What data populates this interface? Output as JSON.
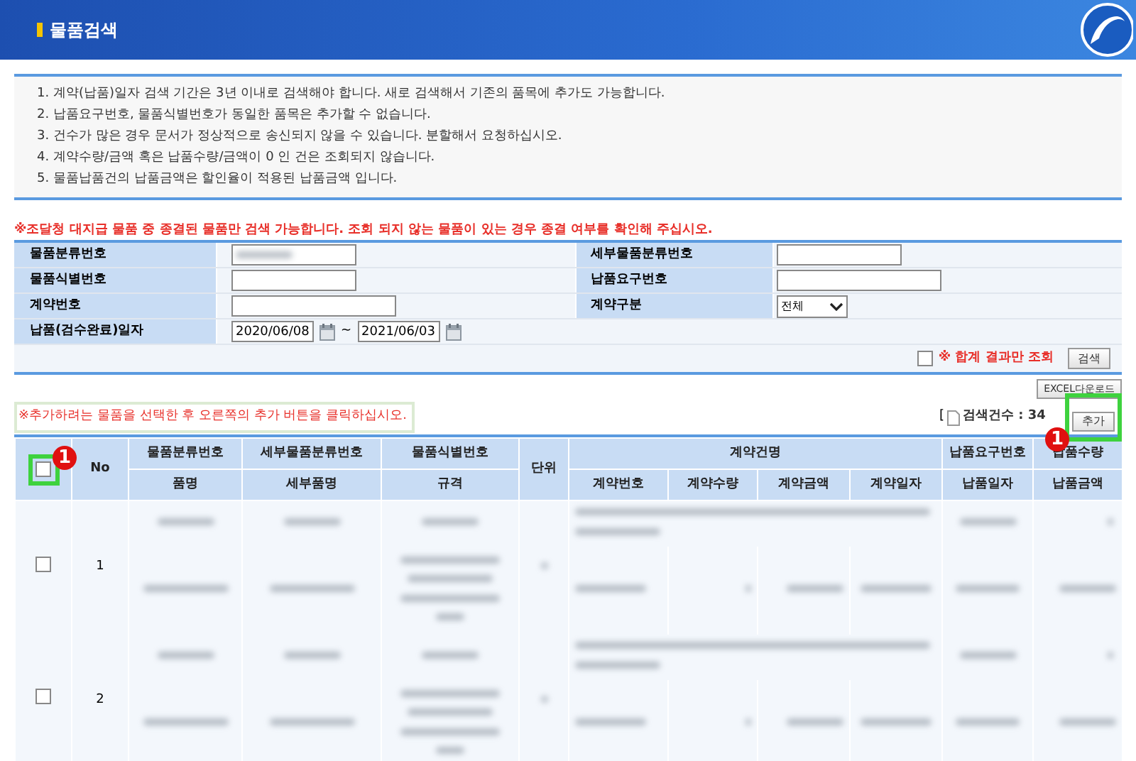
{
  "header": {
    "title": "물품검색"
  },
  "notes": [
    "1.  계약(납품)일자 검색 기간은 3년 이내로 검색해야 합니다. 새로 검색해서 기존의 품목에 추가도 가능합니다.",
    "2.  납품요구번호, 물품식별번호가 동일한 품목은 추가할 수 없습니다.",
    "3.  건수가 많은 경우 문서가 정상적으로 송신되지 않을 수 있습니다. 분할해서 요청하십시오.",
    "4.  계약수량/금액 혹은 납품수량/금액이 0 인 건은 조회되지 않습니다.",
    "5.  물품납품건의 납품금액은 할인율이 적용된 납품금액 입니다."
  ],
  "warning": "※조달청 대지급 물품 중 종결된 물품만 검색 가능합니다. 조회 되지 않는 물품이 있는 경우 종결 여부를 확인해 주십시오.",
  "form": {
    "rows": [
      {
        "label": "물품분류번호",
        "field": {
          "kind": "blurred"
        },
        "label2": "세부물품분류번호",
        "field2": {
          "kind": "text"
        }
      },
      {
        "label": "물품식별번호",
        "field": {
          "kind": "text"
        },
        "label2": "납품요구번호",
        "field2": {
          "kind": "wide"
        }
      },
      {
        "label": "계약번호",
        "field": {
          "kind": "wide"
        },
        "label2": "계약구분",
        "field2": {
          "kind": "select",
          "value": "전체"
        }
      },
      {
        "label": "납품(검수완료)일자",
        "field": {
          "kind": "date_range",
          "from": "2020/06/08",
          "sep": "~",
          "to": "2021/06/03"
        }
      }
    ],
    "sum_only": {
      "label": "※ 합계 결과만 조회",
      "checked": false
    },
    "search_button": "검색"
  },
  "excel_button": "EXCEL다운로드",
  "hint": "※추가하려는 물품을 선택한 후 오른쪽의 추가 버튼을 클릭하십시오.",
  "count": {
    "open": "[",
    "text": "검색건수 : 34"
  },
  "add_button": "추가",
  "table": {
    "no_header": "No",
    "select_all_checked": false,
    "header_top": [
      "물품분류번호",
      "세부물품분류번호",
      "물품식별번호"
    ],
    "unit_header": "단위",
    "contract_group": "계약건명",
    "header_top_right": [
      "납품요구번호",
      "납품수량"
    ],
    "header_bottom": [
      "품명",
      "세부품명",
      "규격",
      "계약번호",
      "계약수량",
      "계약금액",
      "계약일자",
      "납품일자",
      "납품금액"
    ],
    "rows": [
      {
        "no": "1",
        "checked": false
      },
      {
        "no": "2",
        "checked": false
      }
    ]
  },
  "annotations": [
    {
      "label": "1"
    },
    {
      "label": "1"
    }
  ]
}
